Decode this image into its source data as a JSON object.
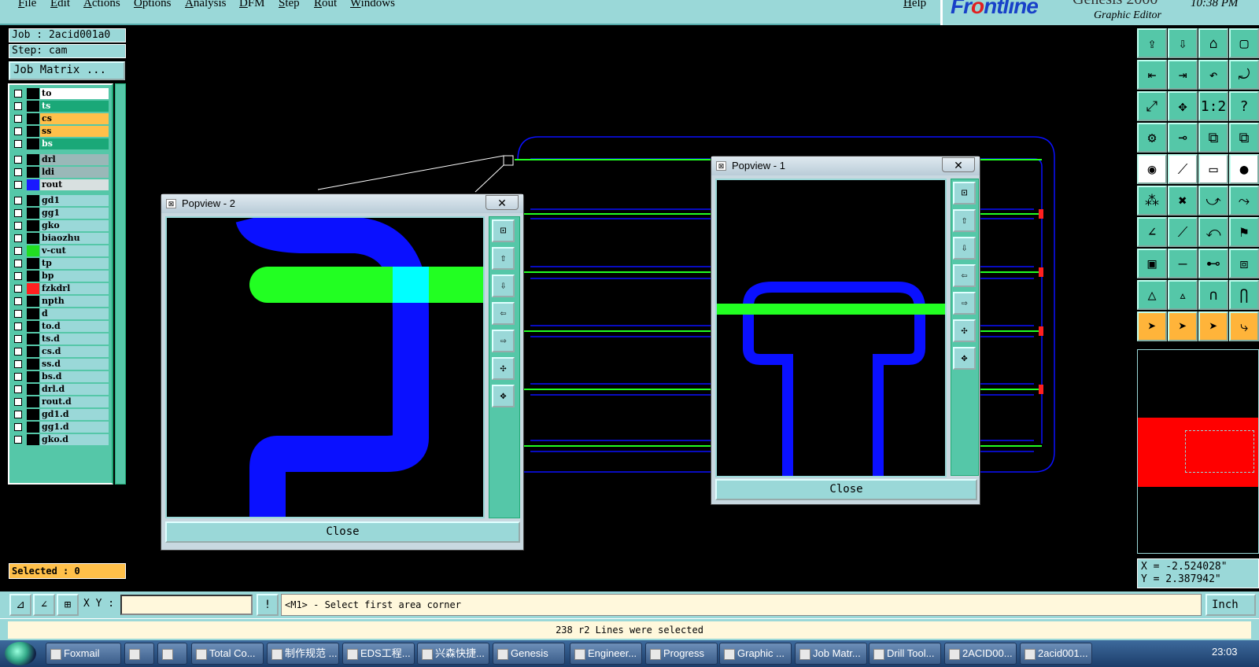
{
  "menu": [
    "File",
    "Edit",
    "Actions",
    "Options",
    "Analysis",
    "DFM",
    "Step",
    "Rout",
    "Windows",
    "Help"
  ],
  "brand": {
    "logo_a": "Fr",
    "logo_o": "o",
    "logo_b": "ntline",
    "genesis": "Genesis 2000",
    "subtitle": "Graphic Editor",
    "time": "10:38 PM"
  },
  "job": {
    "job": "Job : 2acid001a0",
    "step": "Step: cam",
    "matrix_button": "Job Matrix ..."
  },
  "layers": [
    {
      "name": "to",
      "bg": "#ffffff",
      "swatch": "#000000"
    },
    {
      "name": "ts",
      "bg": "#1aa878",
      "swatch": "#000000"
    },
    {
      "name": "cs",
      "bg": "#ffc04a",
      "swatch": "#000000"
    },
    {
      "name": "ss",
      "bg": "#ffc04a",
      "swatch": "#000000"
    },
    {
      "name": "bs",
      "bg": "#1aa878",
      "swatch": "#000000"
    },
    {
      "name": "drl",
      "bg": "#9ab8b8",
      "swatch": "#000000"
    },
    {
      "name": "ldi",
      "bg": "#9ab8b8",
      "swatch": "#000000"
    },
    {
      "name": "rout",
      "bg": "#d8e0e0",
      "swatch": "#1a1aff"
    },
    {
      "name": "gd1",
      "bg": "#9ad8d8",
      "swatch": "#000000"
    },
    {
      "name": "gg1",
      "bg": "#9ad8d8",
      "swatch": "#000000"
    },
    {
      "name": "gko",
      "bg": "#9ad8d8",
      "swatch": "#000000"
    },
    {
      "name": "biaozhu",
      "bg": "#9ad8d8",
      "swatch": "#000000"
    },
    {
      "name": "v-cut",
      "bg": "#9ad8d8",
      "swatch": "#22dd22"
    },
    {
      "name": "tp",
      "bg": "#9ad8d8",
      "swatch": "#000000"
    },
    {
      "name": "bp",
      "bg": "#9ad8d8",
      "swatch": "#000000"
    },
    {
      "name": "fzkdrl",
      "bg": "#9ad8d8",
      "swatch": "#ff2020"
    },
    {
      "name": "npth",
      "bg": "#9ad8d8",
      "swatch": "#000000"
    },
    {
      "name": "d",
      "bg": "#9ad8d8",
      "swatch": "#000000"
    },
    {
      "name": "to.d",
      "bg": "#9ad8d8",
      "swatch": "#000000"
    },
    {
      "name": "ts.d",
      "bg": "#9ad8d8",
      "swatch": "#000000"
    },
    {
      "name": "cs.d",
      "bg": "#9ad8d8",
      "swatch": "#000000"
    },
    {
      "name": "ss.d",
      "bg": "#9ad8d8",
      "swatch": "#000000"
    },
    {
      "name": "bs.d",
      "bg": "#9ad8d8",
      "swatch": "#000000"
    },
    {
      "name": "drl.d",
      "bg": "#9ad8d8",
      "swatch": "#000000"
    },
    {
      "name": "rout.d",
      "bg": "#9ad8d8",
      "swatch": "#000000"
    },
    {
      "name": "gd1.d",
      "bg": "#9ad8d8",
      "swatch": "#000000"
    },
    {
      "name": "gg1.d",
      "bg": "#9ad8d8",
      "swatch": "#000000"
    },
    {
      "name": "gko.d",
      "bg": "#9ad8d8",
      "swatch": "#000000"
    }
  ],
  "selected": "Selected : 0",
  "coords": {
    "x": "X = -2.524028\"",
    "y": "Y = 2.387942\""
  },
  "popview2": {
    "title": "Popview - 2",
    "close": "Close",
    "x": "✕"
  },
  "popview1": {
    "title": "Popview - 1",
    "close": "Close",
    "x": "✕"
  },
  "cmd": {
    "xy_label": "X Y :",
    "xy_value": "",
    "prompt": "<M1> - Select first area corner",
    "unit": "Inch"
  },
  "status": "238 r2 Lines were selected",
  "taskbar": {
    "items": [
      "Foxmail",
      "",
      "",
      "Total Co...",
      "制作规范 ...",
      "EDS工程...",
      "兴森快捷...",
      "Genesis",
      "Engineer...",
      "Progress",
      "Graphic ...",
      "Job Matr...",
      "Drill Tool...",
      "2ACID00...",
      "2acid001..."
    ],
    "clock": "23:03"
  },
  "colors": {
    "accent_teal": "#9ad8d8",
    "panel_green": "#55c7a8",
    "rout_blue": "#0a10ff",
    "vcut_green": "#22ff22",
    "highlight_red": "#ff0000"
  }
}
